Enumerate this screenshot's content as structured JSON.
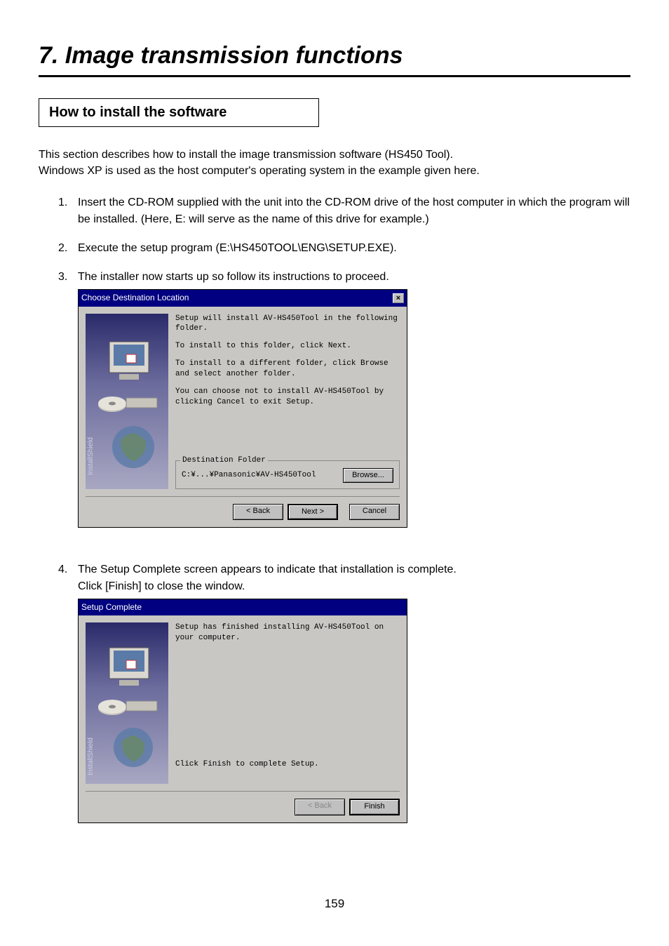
{
  "chapter": {
    "title": "7. Image transmission functions"
  },
  "section": {
    "title": "How to install the software"
  },
  "intro": {
    "line1": "This section describes how to install the image transmission software (HS450 Tool).",
    "line2": "Windows XP is used as the host computer's operating system in the example given here."
  },
  "steps": {
    "s1": {
      "num": "1.",
      "text": "Insert the CD-ROM supplied with the unit into the CD-ROM drive of the host computer in which the program will be installed. (Here, E: will serve as the name of this drive for example.)"
    },
    "s2": {
      "num": "2.",
      "text": "Execute the setup program (E:\\HS450TOOL\\ENG\\SETUP.EXE)."
    },
    "s3": {
      "num": "3.",
      "text": "The installer now starts up so follow its instructions to proceed."
    },
    "s4": {
      "num": "4.",
      "text": "The Setup Complete screen appears to indicate that installation is complete.\nClick [Finish] to close the window."
    }
  },
  "dialog1": {
    "title": "Choose Destination Location",
    "close": "×",
    "p1": "Setup will install AV-HS450Tool in the following folder.",
    "p2": "To install to this folder, click Next.",
    "p3": "To install to a different folder, click Browse and select another folder.",
    "p4": "You can choose not to install AV-HS450Tool by clicking Cancel to exit Setup.",
    "dest_legend": "Destination Folder",
    "dest_path": "C:¥...¥Panasonic¥AV-HS450Tool",
    "browse": "Browse...",
    "back": "< Back",
    "next": "Next >",
    "cancel": "Cancel"
  },
  "dialog2": {
    "title": "Setup Complete",
    "p1": "Setup has finished installing AV-HS450Tool on your computer.",
    "p2": "Click Finish to complete Setup.",
    "back": "< Back",
    "finish": "Finish"
  },
  "page_number": "159"
}
